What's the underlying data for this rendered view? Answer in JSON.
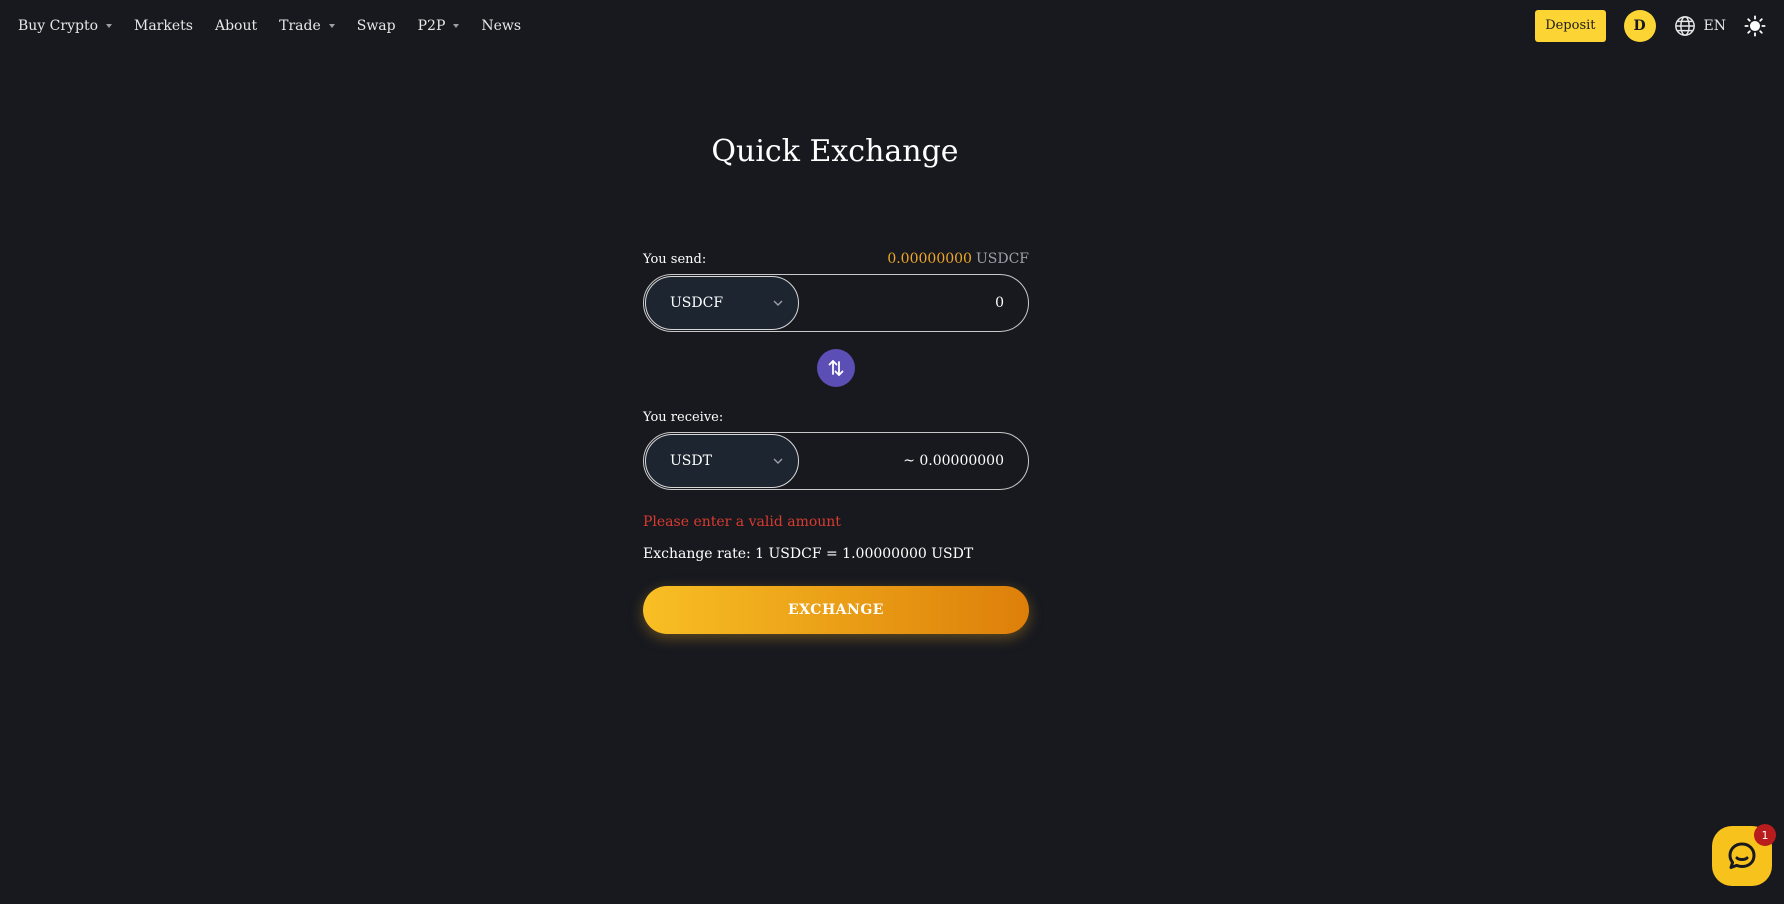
{
  "nav": {
    "items": [
      {
        "label": "Buy Crypto",
        "dropdown": true
      },
      {
        "label": "Markets",
        "dropdown": false
      },
      {
        "label": "About",
        "dropdown": false
      },
      {
        "label": "Trade",
        "dropdown": true
      },
      {
        "label": "Swap",
        "dropdown": false
      },
      {
        "label": "P2P",
        "dropdown": true
      },
      {
        "label": "News",
        "dropdown": false
      }
    ],
    "deposit_label": "Deposit",
    "avatar_initial": "D",
    "language": "EN"
  },
  "page": {
    "title": "Quick Exchange"
  },
  "send": {
    "label": "You send:",
    "balance": "0.00000000",
    "balance_unit": "USDCF",
    "currency": "USDCF",
    "amount": "0"
  },
  "receive": {
    "label": "You receive:",
    "currency": "USDT",
    "amount": "~ 0.00000000"
  },
  "error_message": "Please enter a valid amount",
  "exchange_rate": "Exchange rate: 1 USDCF = 1.00000000 USDT",
  "exchange_button_label": "EXCHANGE",
  "chat": {
    "badge_count": "1"
  },
  "colors": {
    "background": "#17191f",
    "accent_yellow": "#fcd535",
    "swap_button": "#5b4fb5",
    "error": "#d93b2f",
    "balance": "#f0a826"
  },
  "icons": {
    "language": "globe-icon",
    "theme": "sun-icon",
    "swap": "swap-arrows-icon",
    "select": "chevron-down-icon",
    "chat": "chat-bubble-icon"
  }
}
